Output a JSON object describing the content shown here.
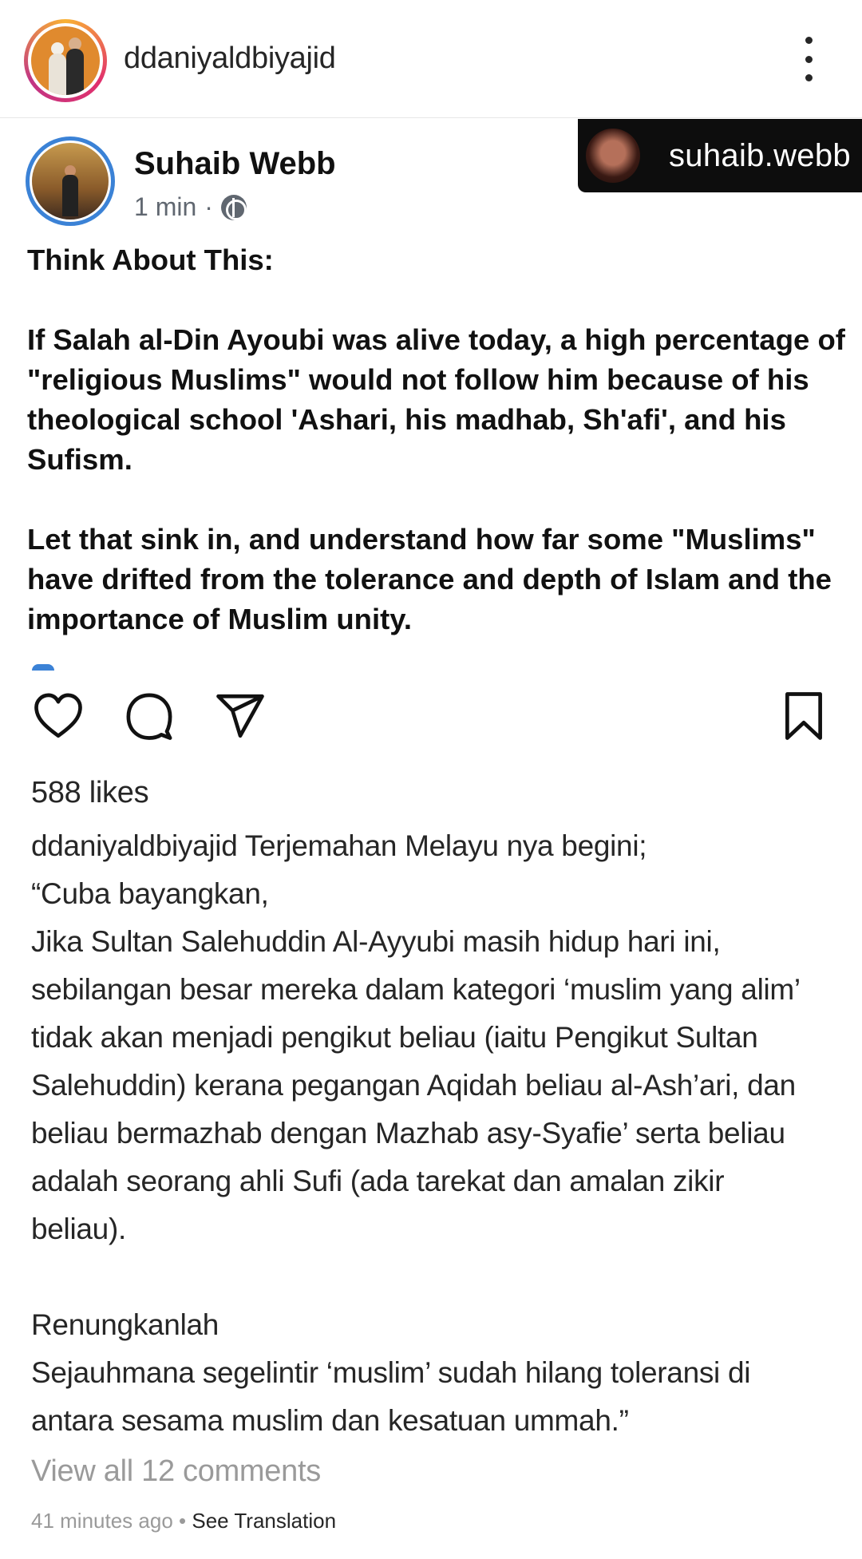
{
  "header": {
    "username": "ddaniyaldbiyajid"
  },
  "post_image": {
    "tag_username": "suhaib.webb",
    "author_name": "Suhaib Webb",
    "time": "1 min",
    "separator": "·",
    "paragraphs": [
      "Think About This:",
      "If Salah al-Din Ayoubi was alive today, a high percentage of \"religious Muslims\" would not follow him because of his theological school 'Ashari, his madhab, Sh'afi', and his Sufism.",
      "Let that sink in, and understand how far some \"Muslims\" have drifted from the tolerance and depth of Islam and the importance of Muslim unity."
    ]
  },
  "likes": "588 likes",
  "caption": {
    "username": "ddaniyaldbiyajid",
    "first_line": " Terjemahan Melayu nya begini;",
    "lines": [
      "“Cuba bayangkan,",
      "Jika Sultan Salehuddin Al-Ayyubi masih hidup hari ini,",
      "sebilangan besar mereka dalam kategori ‘muslim yang alim’",
      "tidak akan menjadi pengikut beliau (iaitu Pengikut Sultan",
      "Salehuddin) kerana pegangan Aqidah beliau al-Ash’ari, dan",
      "beliau bermazhab dengan Mazhab asy-Syafie’ serta beliau",
      "adalah seorang ahli Sufi (ada tarekat dan amalan zikir",
      "beliau)."
    ],
    "lines2": [
      "Renungkanlah",
      "Sejauhmana segelintir ‘muslim’ sudah hilang toleransi di",
      "antara sesama muslim dan kesatuan ummah.”"
    ]
  },
  "view_comments": "View all 12 comments",
  "footer": {
    "time_ago": "41 minutes ago",
    "dot": " • ",
    "see_translation": "See Translation"
  },
  "icons": {
    "more": "more-options-icon",
    "like": "heart-icon",
    "comment": "comment-bubble-icon",
    "share": "paper-plane-icon",
    "save": "bookmark-icon",
    "globe": "globe-icon"
  }
}
